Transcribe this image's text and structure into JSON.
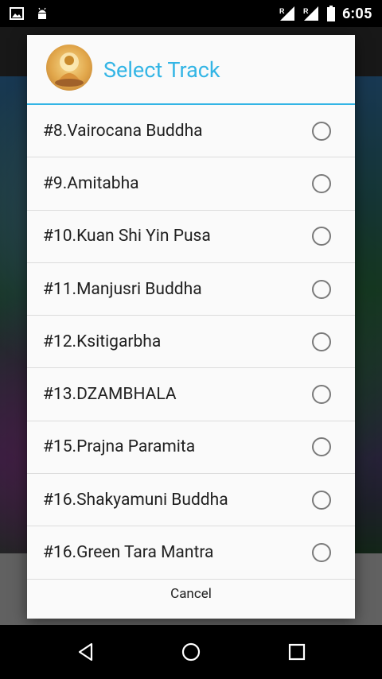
{
  "status_bar": {
    "time": "6:05",
    "left_icons": [
      "image-icon",
      "android-icon"
    ],
    "right_icons": [
      "signal-roaming-icon",
      "signal-roaming-icon",
      "battery-icon"
    ],
    "roaming_label": "R"
  },
  "dialog": {
    "title": "Select Track",
    "accent_color": "#33b5e5",
    "tracks": [
      {
        "label": "#8.Vairocana Buddha",
        "selected": false
      },
      {
        "label": "#9.Amitabha",
        "selected": false
      },
      {
        "label": "#10.Kuan Shi Yin Pusa",
        "selected": false
      },
      {
        "label": "#11.Manjusri Buddha",
        "selected": false
      },
      {
        "label": "#12.Ksitigarbha",
        "selected": false
      },
      {
        "label": "#13.DZAMBHALA",
        "selected": false
      },
      {
        "label": "#15.Prajna Paramita",
        "selected": false
      },
      {
        "label": "#16.Shakyamuni Buddha",
        "selected": false
      },
      {
        "label": "#16.Green Tara Mantra",
        "selected": false
      }
    ],
    "cancel_label": "Cancel"
  },
  "nav_bar": {
    "buttons": [
      "back-icon",
      "home-icon",
      "recents-icon"
    ]
  }
}
